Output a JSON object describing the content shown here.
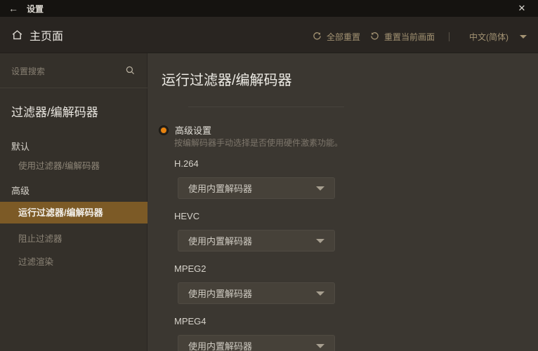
{
  "titlebar": {
    "title": "设置",
    "back_glyph": "←",
    "close_glyph": "✕"
  },
  "header": {
    "page_title": "主页面",
    "reset_all_label": "全部重置",
    "reset_current_label": "重置当前画面",
    "language_selected": "中文(简体)"
  },
  "sidebar": {
    "search_placeholder": "设置搜索",
    "section_title": "过滤器/编解码器",
    "groups": [
      {
        "label": "默认",
        "items": [
          {
            "label": "使用过滤器/编解码器",
            "selected": false
          }
        ]
      },
      {
        "label": "高级",
        "items": [
          {
            "label": "运行过滤器/编解码器",
            "selected": true
          },
          {
            "label": "阻止过滤器",
            "selected": false
          },
          {
            "label": "过滤渲染",
            "selected": false
          }
        ]
      }
    ]
  },
  "main": {
    "title": "运行过滤器/编解码器",
    "radio": {
      "label": "高级设置",
      "selected": true,
      "description": "按编解码器手动选择是否使用硬件激素功能。"
    },
    "codecs": [
      {
        "label": "H.264",
        "value": "使用内置解码器"
      },
      {
        "label": "HEVC",
        "value": "使用内置解码器"
      },
      {
        "label": "MPEG2",
        "value": "使用内置解码器"
      },
      {
        "label": "MPEG4",
        "value": "使用内置解码器"
      }
    ]
  },
  "icons": {
    "back": "arrow-left-icon",
    "close": "close-icon",
    "home": "home-icon",
    "reset_all": "reset-all-circular-arrow-icon",
    "reset_current": "reset-current-circular-arrow-icon",
    "search": "search-icon",
    "dropdown": "chevron-down-icon"
  },
  "colors": {
    "accent_orange": "#e8830f",
    "selected_item_bg": "#7c5a26",
    "titlebar_bg": "#151310",
    "header_bg": "#292521",
    "sidebar_bg": "#34302a",
    "main_bg": "#3b3731",
    "dropdown_bg": "#464139"
  }
}
